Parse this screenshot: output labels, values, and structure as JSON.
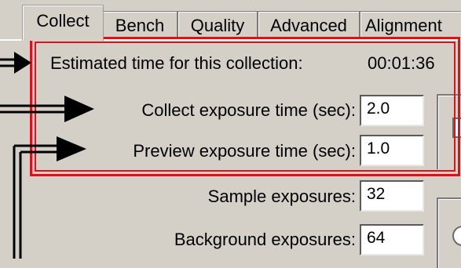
{
  "tabs": [
    {
      "label": "Collect",
      "active": true
    },
    {
      "label": "Bench",
      "active": false
    },
    {
      "label": "Quality",
      "active": false
    },
    {
      "label": "Advanced",
      "active": false
    },
    {
      "label": "Alignment",
      "active": false
    }
  ],
  "estimated": {
    "label": "Estimated time for this collection:",
    "value": "00:01:36"
  },
  "fields": {
    "collect_exposure": {
      "label": "Collect exposure time (sec):",
      "value": "2.0"
    },
    "preview_exposure": {
      "label": "Preview exposure time (sec):",
      "value": "1.0"
    },
    "sample_exposures": {
      "label": "Sample exposures:",
      "value": "32"
    },
    "background_exposures": {
      "label": "Background exposures:",
      "value": "64"
    }
  },
  "colors": {
    "highlight": "#e0101a",
    "background": "#d4d0c8"
  }
}
